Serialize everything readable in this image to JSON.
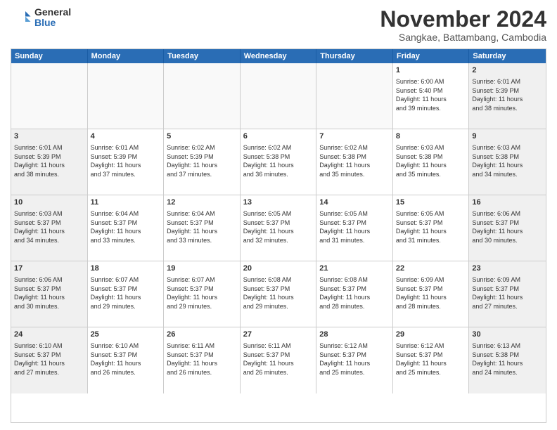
{
  "logo": {
    "general": "General",
    "blue": "Blue"
  },
  "title": "November 2024",
  "subtitle": "Sangkae, Battambang, Cambodia",
  "days": [
    "Sunday",
    "Monday",
    "Tuesday",
    "Wednesday",
    "Thursday",
    "Friday",
    "Saturday"
  ],
  "weeks": [
    [
      {
        "day": "",
        "content": ""
      },
      {
        "day": "",
        "content": ""
      },
      {
        "day": "",
        "content": ""
      },
      {
        "day": "",
        "content": ""
      },
      {
        "day": "",
        "content": ""
      },
      {
        "day": "1",
        "content": "Sunrise: 6:00 AM\nSunset: 5:40 PM\nDaylight: 11 hours\nand 39 minutes."
      },
      {
        "day": "2",
        "content": "Sunrise: 6:01 AM\nSunset: 5:39 PM\nDaylight: 11 hours\nand 38 minutes."
      }
    ],
    [
      {
        "day": "3",
        "content": "Sunrise: 6:01 AM\nSunset: 5:39 PM\nDaylight: 11 hours\nand 38 minutes."
      },
      {
        "day": "4",
        "content": "Sunrise: 6:01 AM\nSunset: 5:39 PM\nDaylight: 11 hours\nand 37 minutes."
      },
      {
        "day": "5",
        "content": "Sunrise: 6:02 AM\nSunset: 5:39 PM\nDaylight: 11 hours\nand 37 minutes."
      },
      {
        "day": "6",
        "content": "Sunrise: 6:02 AM\nSunset: 5:38 PM\nDaylight: 11 hours\nand 36 minutes."
      },
      {
        "day": "7",
        "content": "Sunrise: 6:02 AM\nSunset: 5:38 PM\nDaylight: 11 hours\nand 35 minutes."
      },
      {
        "day": "8",
        "content": "Sunrise: 6:03 AM\nSunset: 5:38 PM\nDaylight: 11 hours\nand 35 minutes."
      },
      {
        "day": "9",
        "content": "Sunrise: 6:03 AM\nSunset: 5:38 PM\nDaylight: 11 hours\nand 34 minutes."
      }
    ],
    [
      {
        "day": "10",
        "content": "Sunrise: 6:03 AM\nSunset: 5:37 PM\nDaylight: 11 hours\nand 34 minutes."
      },
      {
        "day": "11",
        "content": "Sunrise: 6:04 AM\nSunset: 5:37 PM\nDaylight: 11 hours\nand 33 minutes."
      },
      {
        "day": "12",
        "content": "Sunrise: 6:04 AM\nSunset: 5:37 PM\nDaylight: 11 hours\nand 33 minutes."
      },
      {
        "day": "13",
        "content": "Sunrise: 6:05 AM\nSunset: 5:37 PM\nDaylight: 11 hours\nand 32 minutes."
      },
      {
        "day": "14",
        "content": "Sunrise: 6:05 AM\nSunset: 5:37 PM\nDaylight: 11 hours\nand 31 minutes."
      },
      {
        "day": "15",
        "content": "Sunrise: 6:05 AM\nSunset: 5:37 PM\nDaylight: 11 hours\nand 31 minutes."
      },
      {
        "day": "16",
        "content": "Sunrise: 6:06 AM\nSunset: 5:37 PM\nDaylight: 11 hours\nand 30 minutes."
      }
    ],
    [
      {
        "day": "17",
        "content": "Sunrise: 6:06 AM\nSunset: 5:37 PM\nDaylight: 11 hours\nand 30 minutes."
      },
      {
        "day": "18",
        "content": "Sunrise: 6:07 AM\nSunset: 5:37 PM\nDaylight: 11 hours\nand 29 minutes."
      },
      {
        "day": "19",
        "content": "Sunrise: 6:07 AM\nSunset: 5:37 PM\nDaylight: 11 hours\nand 29 minutes."
      },
      {
        "day": "20",
        "content": "Sunrise: 6:08 AM\nSunset: 5:37 PM\nDaylight: 11 hours\nand 29 minutes."
      },
      {
        "day": "21",
        "content": "Sunrise: 6:08 AM\nSunset: 5:37 PM\nDaylight: 11 hours\nand 28 minutes."
      },
      {
        "day": "22",
        "content": "Sunrise: 6:09 AM\nSunset: 5:37 PM\nDaylight: 11 hours\nand 28 minutes."
      },
      {
        "day": "23",
        "content": "Sunrise: 6:09 AM\nSunset: 5:37 PM\nDaylight: 11 hours\nand 27 minutes."
      }
    ],
    [
      {
        "day": "24",
        "content": "Sunrise: 6:10 AM\nSunset: 5:37 PM\nDaylight: 11 hours\nand 27 minutes."
      },
      {
        "day": "25",
        "content": "Sunrise: 6:10 AM\nSunset: 5:37 PM\nDaylight: 11 hours\nand 26 minutes."
      },
      {
        "day": "26",
        "content": "Sunrise: 6:11 AM\nSunset: 5:37 PM\nDaylight: 11 hours\nand 26 minutes."
      },
      {
        "day": "27",
        "content": "Sunrise: 6:11 AM\nSunset: 5:37 PM\nDaylight: 11 hours\nand 26 minutes."
      },
      {
        "day": "28",
        "content": "Sunrise: 6:12 AM\nSunset: 5:37 PM\nDaylight: 11 hours\nand 25 minutes."
      },
      {
        "day": "29",
        "content": "Sunrise: 6:12 AM\nSunset: 5:37 PM\nDaylight: 11 hours\nand 25 minutes."
      },
      {
        "day": "30",
        "content": "Sunrise: 6:13 AM\nSunset: 5:38 PM\nDaylight: 11 hours\nand 24 minutes."
      }
    ]
  ]
}
